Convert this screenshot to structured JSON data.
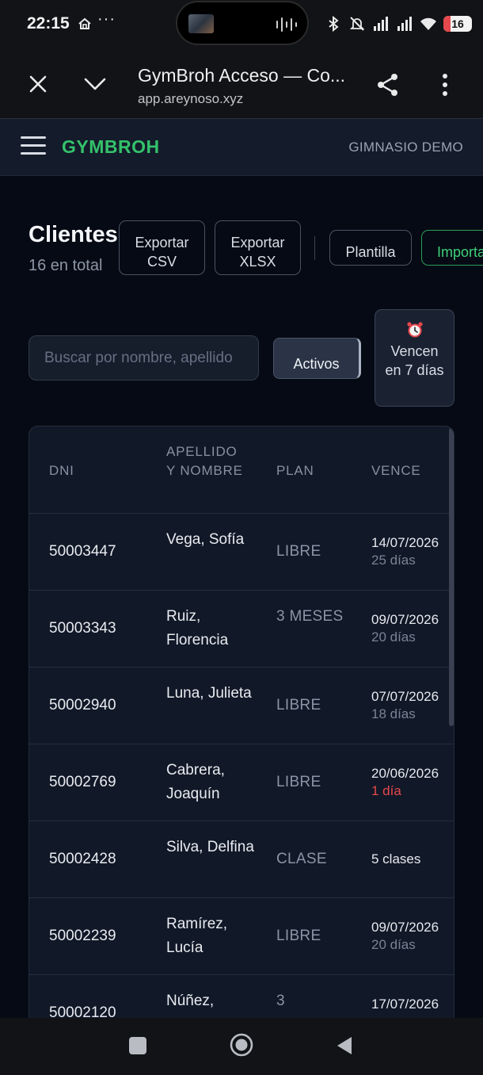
{
  "status_bar": {
    "time": "22:15",
    "dots": "···",
    "battery": "16",
    "icons": [
      "home-icon",
      "bluetooth-icon",
      "silent-icon",
      "signal-icon",
      "wifi-icon",
      "battery-icon"
    ]
  },
  "browser": {
    "title": "GymBroh Acceso — Co...",
    "url": "app.areynoso.xyz"
  },
  "app": {
    "brand": "GYMBROH",
    "gym_name": "GIMNASIO DEMO",
    "colors": {
      "brand": "#34c26b",
      "background": "#060a14",
      "urgent": "#e5484d"
    }
  },
  "page": {
    "title": "Clientes",
    "subtitle": "16 en total",
    "actions": {
      "export_csv": "Exportar CSV",
      "export_xlsx": "Exportar XLSX",
      "plantilla": "Plantilla",
      "importar": "Importa"
    }
  },
  "filters": {
    "search_placeholder": "Buscar por nombre, apellido",
    "status_filter": "Activos",
    "expiring_filter": "Vencen en 7 días"
  },
  "table": {
    "headers": {
      "dni": "DNI",
      "nombre": "APELLIDO Y NOMBRE",
      "plan": "PLAN",
      "vence": "VENCE"
    },
    "rows": [
      {
        "dni": "50003447",
        "nombre": "Vega, Sofía",
        "plan": "LIBRE",
        "vence": "14/07/2026",
        "dias": "25 días",
        "urgent": false
      },
      {
        "dni": "50003343",
        "nombre": "Ruiz, Florencia",
        "plan": "3 MESES",
        "vence": "09/07/2026",
        "dias": "20 días",
        "urgent": false
      },
      {
        "dni": "50002940",
        "nombre": "Luna, Julieta",
        "plan": "LIBRE",
        "vence": "07/07/2026",
        "dias": "18 días",
        "urgent": false
      },
      {
        "dni": "50002769",
        "nombre": "Cabrera, Joaquín",
        "plan": "LIBRE",
        "vence": "20/06/2026",
        "dias": "1 día",
        "urgent": true
      },
      {
        "dni": "50002428",
        "nombre": "Silva, Delfina",
        "plan": "CLASE",
        "vence": "5 clases",
        "dias": "",
        "urgent": false
      },
      {
        "dni": "50002239",
        "nombre": "Ramírez, Lucía",
        "plan": "LIBRE",
        "vence": "09/07/2026",
        "dias": "20 días",
        "urgent": false
      },
      {
        "dni": "50002120",
        "nombre": "Núñez,",
        "plan": "3",
        "vence": "17/07/2026",
        "dias": "",
        "urgent": false
      }
    ]
  }
}
